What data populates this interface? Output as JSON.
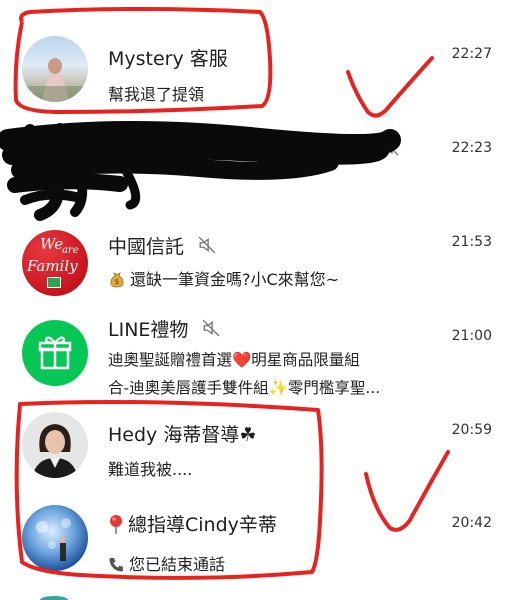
{
  "colors": {
    "line_green": "#06c755",
    "scribble_red": "#e8231f",
    "ctbc_red": "#d11f2c"
  },
  "chats": [
    {
      "name": "Mystery 客服",
      "message": "幫我退了提領",
      "time": "22:27",
      "muted": false,
      "avatar": "photo-avatar"
    },
    {
      "name": "",
      "message": "",
      "time": "22:23",
      "muted": true,
      "redacted": true,
      "partial_visible_text": "/(?(?"
    },
    {
      "name": "中國信託",
      "message": "還缺一筆資金嗎?小C來幫您~",
      "time": "21:53",
      "muted": true,
      "avatar": "ctbc-logo",
      "avatar_text": [
        "We",
        "are",
        "Family"
      ],
      "emoji": "money-bag-icon"
    },
    {
      "name": "LINE禮物",
      "message_lines": [
        "迪奧聖誕贈禮首選❤️明星商品限量組",
        "合-迪奧美唇護手雙件組✨零門檻享聖..."
      ],
      "time": "21:00",
      "muted": true,
      "avatar": "gift-icon"
    },
    {
      "name": "Hedy 海蒂督導☘",
      "message": "難道我被....",
      "time": "20:59",
      "muted": false,
      "avatar": "photo-avatar"
    },
    {
      "name": "總指導Cindy辛蒂",
      "name_prefix_icon": "pin-icon",
      "message": "您已結束通話",
      "message_prefix_icon": "phone-icon",
      "time": "20:42",
      "muted": false,
      "avatar": "photo-avatar"
    }
  ]
}
